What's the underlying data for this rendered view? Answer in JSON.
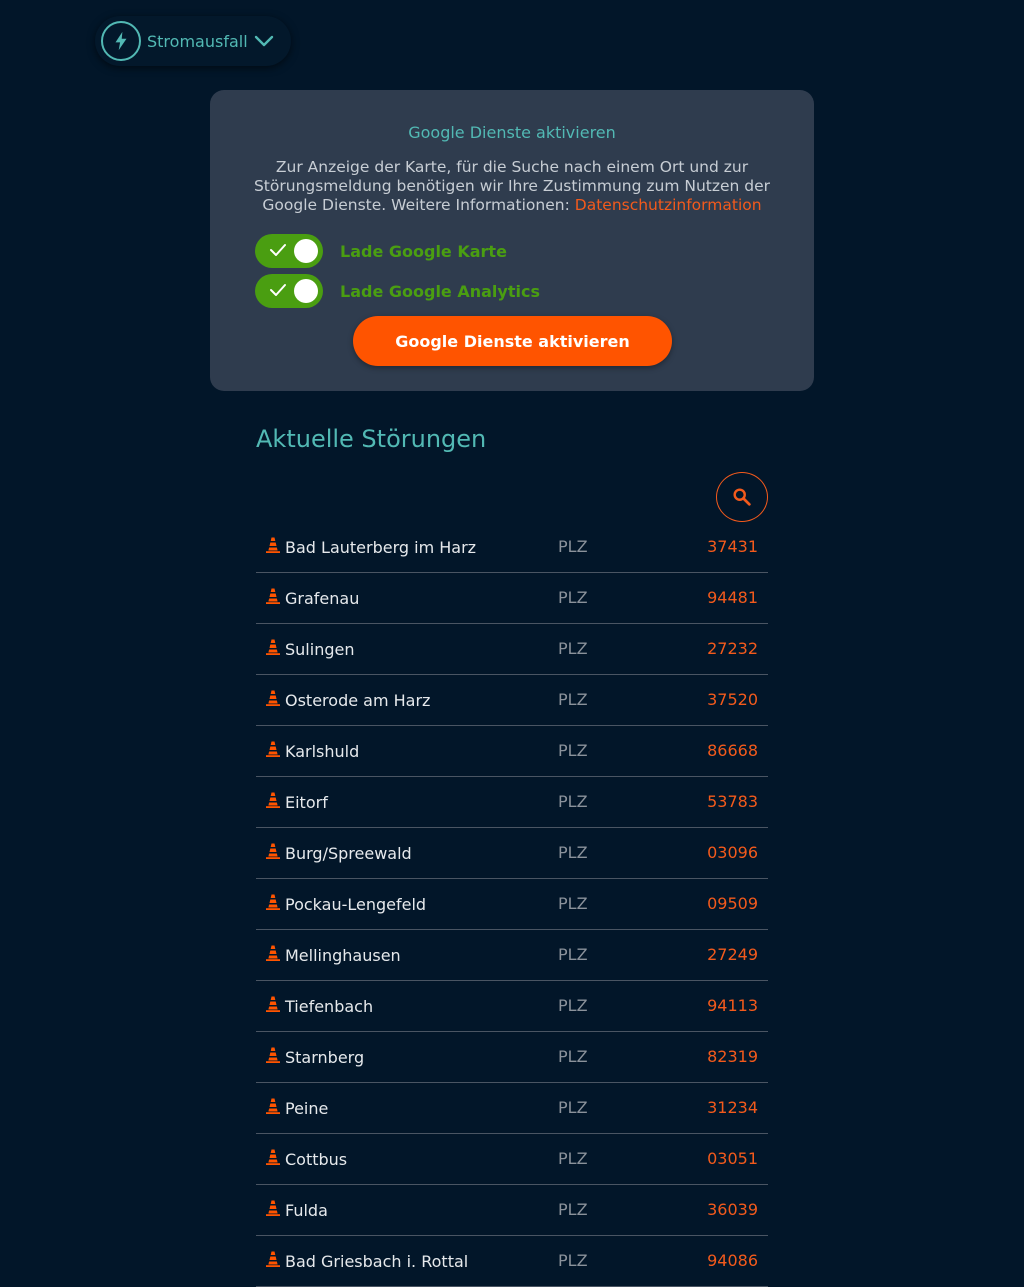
{
  "category": {
    "label": "Stromausfall",
    "icon": "lightning-bolt-icon",
    "accent": "#52b9b4"
  },
  "consent": {
    "title": "Google Dienste aktivieren",
    "text": "Zur Anzeige der Karte, für die Suche nach einem Ort und zur Störungsmeldung benötigen wir Ihre Zustimmung zum Nutzen der Google Dienste. Weitere Informationen: ",
    "link_label": "Datenschutzinformation",
    "toggles": [
      {
        "label": "Lade Google Karte",
        "on": true
      },
      {
        "label": "Lade Google Analytics",
        "on": true
      }
    ],
    "button_label": "Google Dienste aktivieren"
  },
  "outages": {
    "title": "Aktuelle Störungen",
    "plz_label": "PLZ",
    "items": [
      {
        "city": "Bad Lauterberg im Harz",
        "plz": "37431"
      },
      {
        "city": "Grafenau",
        "plz": "94481"
      },
      {
        "city": "Sulingen",
        "plz": "27232"
      },
      {
        "city": "Osterode am Harz",
        "plz": "37520"
      },
      {
        "city": "Karlshuld",
        "plz": "86668"
      },
      {
        "city": "Eitorf",
        "plz": "53783"
      },
      {
        "city": "Burg/Spreewald",
        "plz": "03096"
      },
      {
        "city": "Pockau-Lengefeld",
        "plz": "09509"
      },
      {
        "city": "Mellinghausen",
        "plz": "27249"
      },
      {
        "city": "Tiefenbach",
        "plz": "94113"
      },
      {
        "city": "Starnberg",
        "plz": "82319"
      },
      {
        "city": "Peine",
        "plz": "31234"
      },
      {
        "city": "Cottbus",
        "plz": "03051"
      },
      {
        "city": "Fulda",
        "plz": "36039"
      },
      {
        "city": "Bad Griesbach i. Rottal",
        "plz": "94086"
      }
    ]
  },
  "colors": {
    "background": "#021629",
    "accent_teal": "#52b9b4",
    "accent_orange": "#f35a1c",
    "button_orange": "#ff5400",
    "toggle_green": "#4a9e11",
    "card": "#2f3c4e"
  }
}
